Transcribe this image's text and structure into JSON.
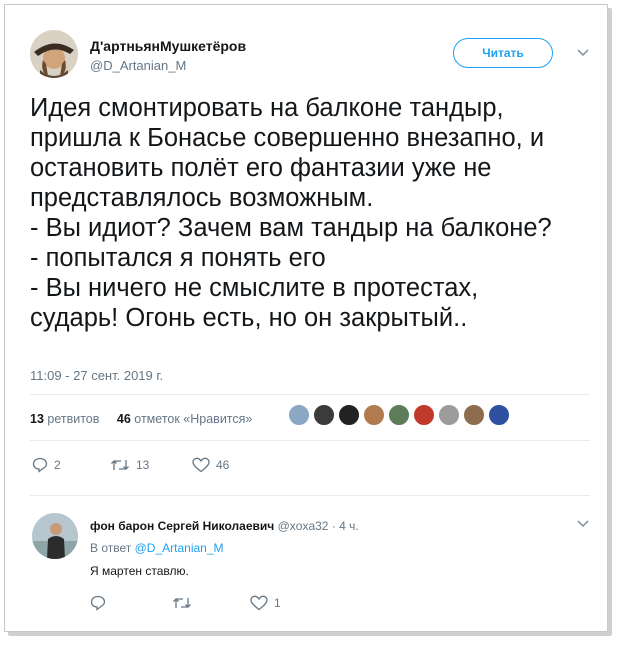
{
  "tweet": {
    "author": {
      "display_name": "Д'артньянМушкетёров",
      "handle": "@D_Artanian_M"
    },
    "follow_label": "Читать",
    "text": "Идея смонтировать на балконе тандыр,\nпришла к Бонасье совершенно внезапно, и\nостановить полёт его фантазии уже не\nпредставлялось возможным.\n- Вы идиот? Зачем вам тандыр на балконе?\n- попытался я понять его\n- Вы ничего не смыслите в протестах,\nсударь! Огонь есть, но он закрытый..",
    "timestamp": "11:09 - 27 сент. 2019 г.",
    "stats": {
      "retweets_count": "13",
      "retweets_label": "ретвитов",
      "likes_count": "46",
      "likes_label": "отметок «Нравится»"
    },
    "actions": {
      "reply": "2",
      "retweet": "13",
      "like": "46"
    },
    "liker_colors": [
      "#8aa7c4",
      "#3b3b3b",
      "#222222",
      "#b07b4f",
      "#5c7c5a",
      "#c0392b",
      "#9c9c9c",
      "#8c6d4f",
      "#2f4f9f"
    ]
  },
  "reply": {
    "author": "фон барон Сергей Николаевич",
    "handle": "@xoxa32",
    "time": " · 4 ч.",
    "reply_to_label": "В ответ",
    "reply_to_handle": "@D_Artanian_M",
    "text": "Я мартен ставлю.",
    "actions": {
      "reply": "",
      "retweet": "",
      "like": "1"
    }
  },
  "colors": {
    "accent": "#1da1f2",
    "muted": "#657786"
  }
}
